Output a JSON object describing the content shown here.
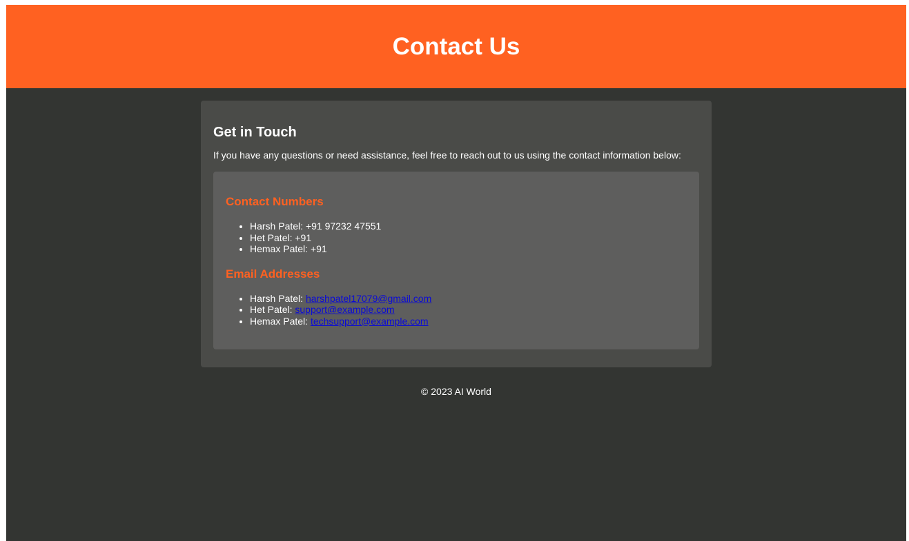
{
  "header": {
    "title": "Contact Us"
  },
  "intro": {
    "heading": "Get in Touch",
    "text": "If you have any questions or need assistance, feel free to reach out to us using the contact information below:"
  },
  "contact_numbers": {
    "heading": "Contact Numbers",
    "items": [
      {
        "name": "Harsh Patel:",
        "value": "+91 97232 47551"
      },
      {
        "name": "Het Patel:",
        "value": "+91"
      },
      {
        "name": "Hemax Patel:",
        "value": "+91"
      }
    ]
  },
  "email_addresses": {
    "heading": "Email Addresses",
    "items": [
      {
        "name": "Harsh Patel:",
        "email": "harshpatel17079@gmail.com"
      },
      {
        "name": "Het Patel:",
        "email": "support@example.com"
      },
      {
        "name": "Hemax Patel:",
        "email": "techsupport@example.com"
      }
    ]
  },
  "footer": {
    "text": "© 2023 AI World"
  },
  "colors": {
    "accent": "#ff6121",
    "page_background": "#333532",
    "card_background": "#4a4b48",
    "info_background": "#5e5e5d",
    "link": "#0b0bd6"
  }
}
